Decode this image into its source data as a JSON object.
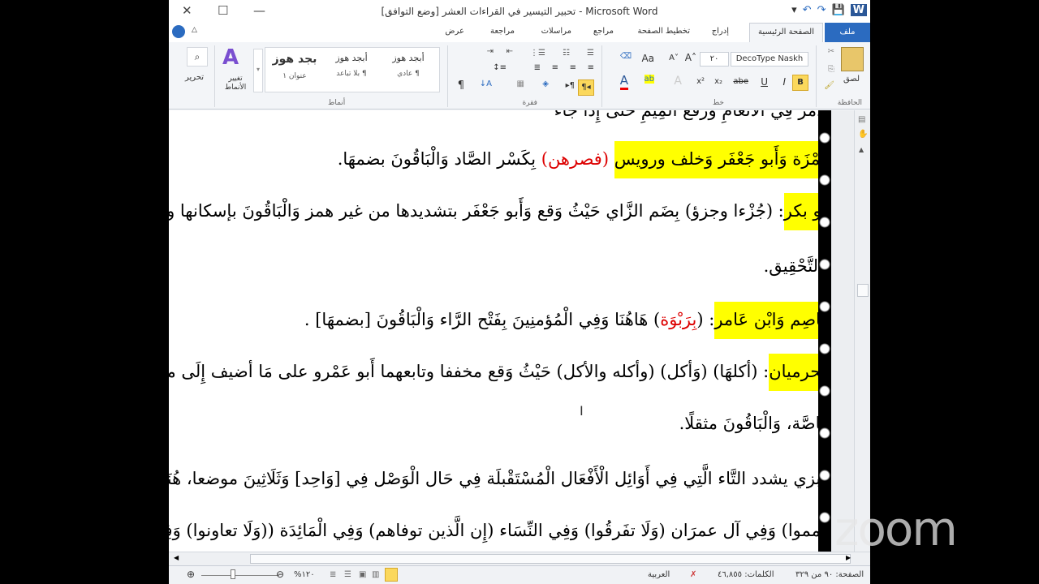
{
  "window": {
    "title": "تحبير التيسير في القراءات العشر [وضع التوافق] - Microsoft Word",
    "close": "✕",
    "maximize": "☐",
    "minimize": "—"
  },
  "qat": {
    "word_icon": "W",
    "save": "💾",
    "redo": "↷",
    "undo": "↶",
    "customize": "▾"
  },
  "tabs": {
    "file": "ملف",
    "home": "الصفحة الرئيسية",
    "insert": "إدراج",
    "layout": "تخطيط الصفحة",
    "references": "مراجع",
    "mailings": "مراسلات",
    "review": "مراجعة",
    "view": "عرض"
  },
  "ribbon": {
    "clipboard": {
      "label": "الحافظة",
      "paste": "لصق"
    },
    "font": {
      "label": "خط",
      "name": "DecoType Naskh",
      "size": "٢٠",
      "bold": "B",
      "italic": "I",
      "underline": "U",
      "strike": "abe",
      "sub": "x₂",
      "sup": "x²",
      "grow": "A˄",
      "shrink": "A˅",
      "case": "Aa"
    },
    "paragraph": {
      "label": "فقرة",
      "pilcrow": "¶",
      "sort": "↓A"
    },
    "styles": {
      "label": "أنماط",
      "items": [
        {
          "preview": "أبجد هوز",
          "name": "¶ عادي"
        },
        {
          "preview": "أبجد هوز",
          "name": "¶ بلا تباعد"
        },
        {
          "preview": "بجد هوز",
          "name": "عنوان ١"
        }
      ],
      "change": "تغيير الأنماط"
    },
    "editing": {
      "label": "تحرير"
    }
  },
  "document": {
    "lines": [
      {
        "parts": [
          {
            "t": "الأَمْرُ فِي الأَنْعَامِ وَرَفْعُ الْمِيمِ حَتَّى إِذَا جَاءَ"
          }
        ]
      },
      {
        "parts": [
          {
            "t": "حَمْزَة وَأَبو جَعْفَر وَخلف ورويس",
            "hl": true
          },
          {
            "t": " "
          },
          {
            "t": "(فصرهن)",
            "red": true
          },
          {
            "t": " بِكَسْر الصَّاد وَالْبَاقُونَ بضمهَا."
          }
        ]
      },
      {
        "parts": [
          {
            "t": "أَبو بكر",
            "hl": true
          },
          {
            "t": ": (جُزْءا وجزؤ) بِضَم الزَّاي حَيْثُ وَقع وَأَبو جَعْفَر بتشديدها من غير همز وَالْبَاقُونَ بإسكانها وبالهمز"
          }
        ]
      },
      {
        "parts": [
          {
            "t": "وَالتَّحْقِيق."
          }
        ]
      },
      {
        "parts": [
          {
            "t": "عَاصِم وَابْن عَامر",
            "hl": true
          },
          {
            "t": ": ("
          },
          {
            "t": "بِرَبْوَة",
            "red": true
          },
          {
            "t": ") هَاهُنَا وَفِي الْمُؤمنِينَ بِفَتْح الرَّاء وَالْبَاقُونَ [بضمهَا] ."
          }
        ]
      },
      {
        "parts": [
          {
            "t": "الحرميان",
            "hl": true
          },
          {
            "t": ": (أكلهَا) (وَأكل) (وأكله والأكل) حَيْثُ وَقع مخففا وتابعهما أَبو عَمْرو على مَا أضيف إِلَى مؤنث"
          }
        ]
      },
      {
        "parts": [
          {
            "t": "خَاصَّة، وَالْبَاقُونَ مثقلًا."
          }
        ]
      },
      {
        "parts": [
          {
            "t": "البزي يشدد التَّاء الَّتِي فِي أَوَائِل الْأَفْعَال الْمُسْتَقْبلَة فِي حَال الْوَصْل فِي [وَاحِد] وَثَلَاثِينَ موضعا، هُنَا (لَا"
          }
        ]
      },
      {
        "parts": [
          {
            "t": "تيمموا) وَفِي آل عمرَان (وَلَا تفَرقُوا) وَفِي النِّسَاء (إِن الَّذين توفاهم) وَفِي الْمَائِدَة ((وَلَا تعاونوا) وَفِي الْأَنْعَام"
          }
        ]
      }
    ]
  },
  "status": {
    "page": "الصفحة: ٩٠ من ٣٢٩",
    "words": "الكلمات: ٤٦,٨٥٥",
    "language": "العربية",
    "zoom": "%١٢٠"
  },
  "overlay": {
    "zoom_logo": "zoom"
  }
}
